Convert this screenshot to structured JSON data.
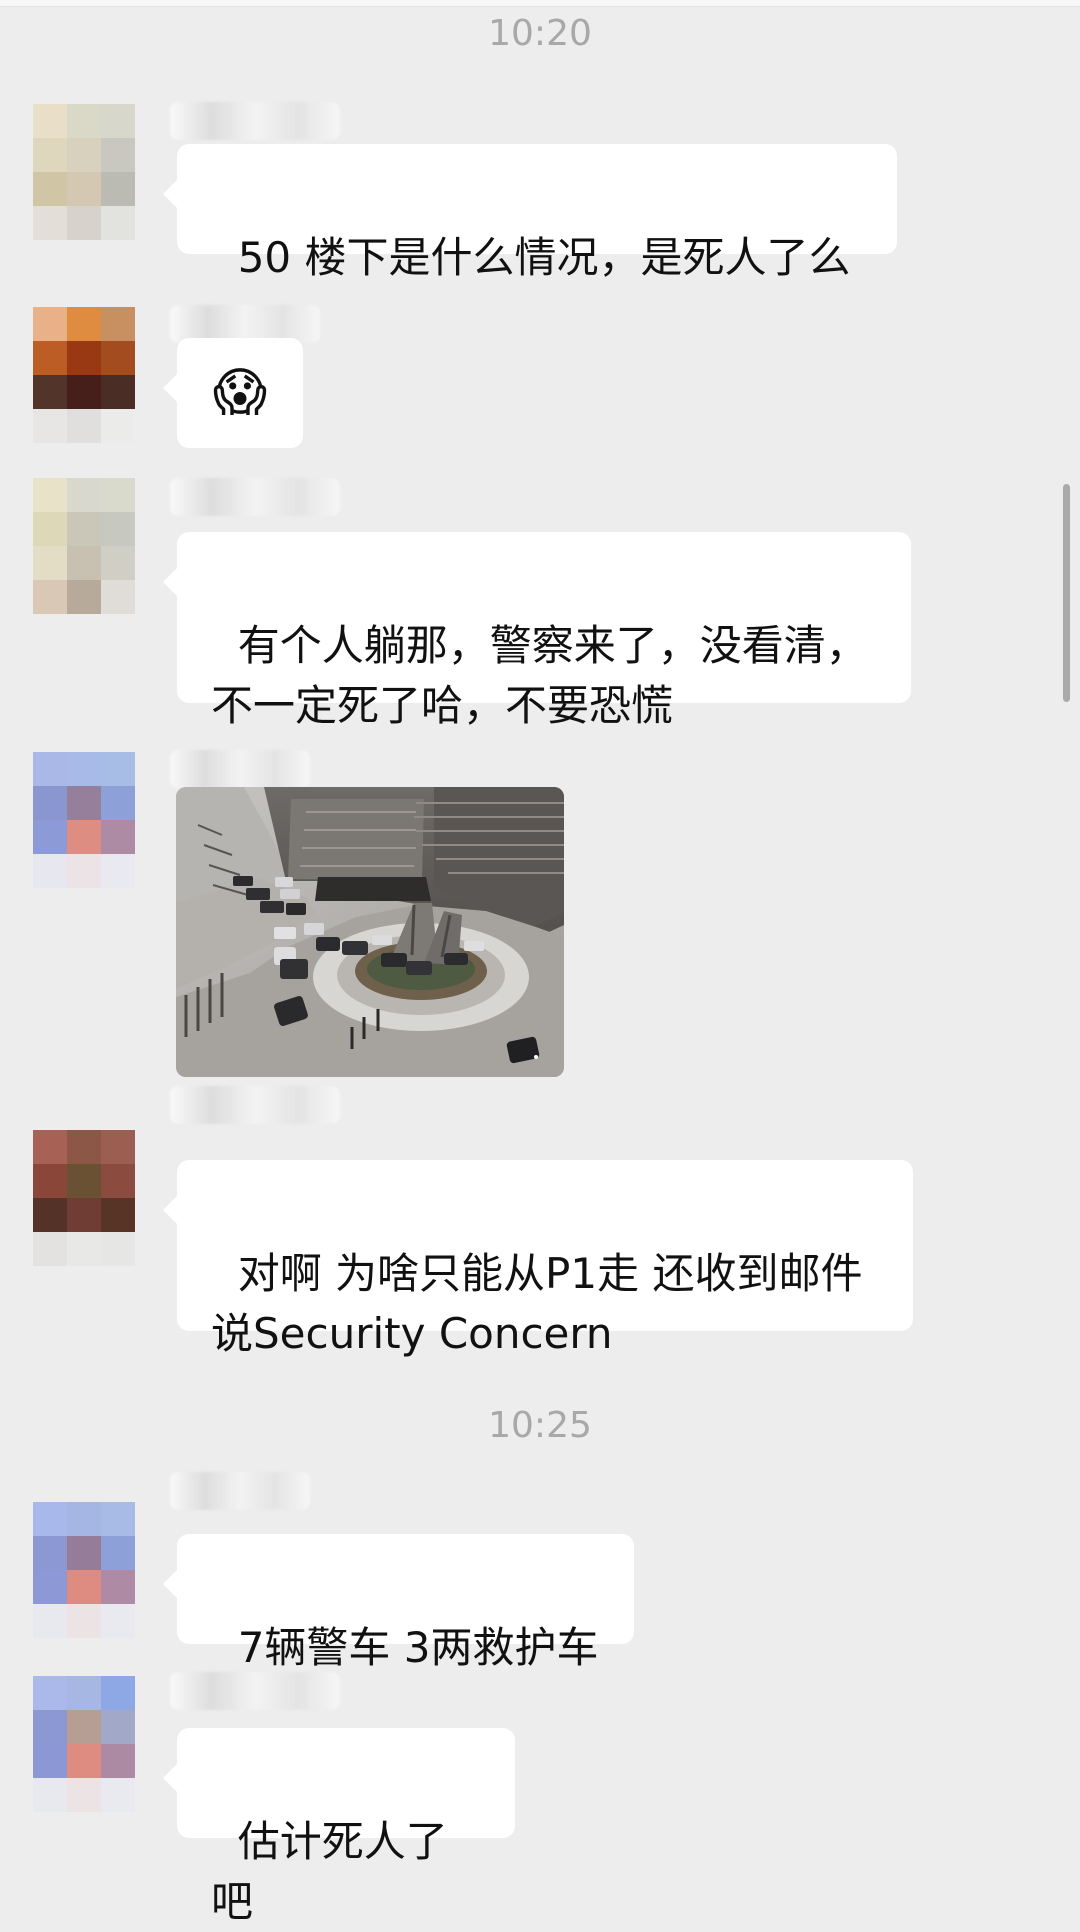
{
  "times": {
    "first": "10:20",
    "second": "10:25"
  },
  "messages": [
    {
      "sender_type": "other",
      "content": "50 楼下是什么情况，是死人了么"
    },
    {
      "sender_type": "other",
      "emoji_icon": "screaming-face-icon",
      "content": "😱"
    },
    {
      "sender_type": "other",
      "content": "有个人躺那，警察来了，没看清，\n不一定死了哈，不要恐慌"
    },
    {
      "sender_type": "other",
      "image_icon": "parking-lot-photo-icon"
    },
    {
      "sender_type": "other",
      "content": "对啊 为啥只能从P1走 还收到邮件\n说Security Concern"
    },
    {
      "sender_type": "other",
      "content": "7辆警车 3两救护车"
    },
    {
      "sender_type": "other",
      "content": "估计死人了吧"
    }
  ],
  "colors": {
    "background": "#ededed",
    "bubble": "#ffffff",
    "text": "#111111",
    "time": "#a8a8a8",
    "scrollbar": "#aaaaaa"
  }
}
